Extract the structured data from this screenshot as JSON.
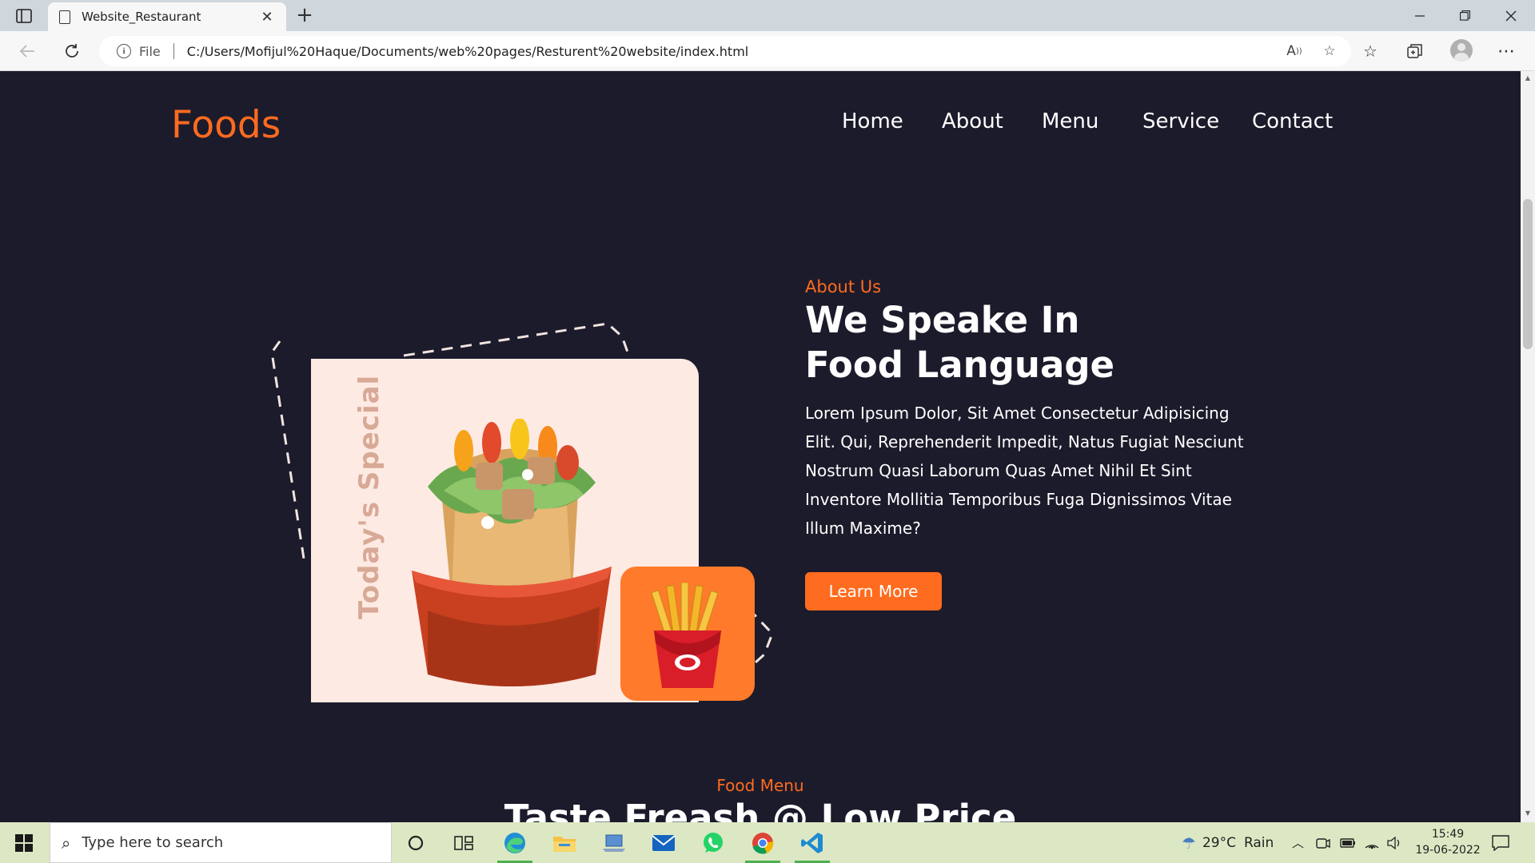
{
  "browser": {
    "tab_title": "Website_Restaurant",
    "address_prefix": "File",
    "url": "C:/Users/Mofijul%20Haque/Documents/web%20pages/Resturent%20website/index.html"
  },
  "site": {
    "logo": "Foods",
    "nav": [
      "Home",
      "About",
      "Menu",
      "Service",
      "Contact"
    ],
    "art_label": "Today's Special",
    "about": {
      "tag": "About Us",
      "title_line1": "We Speake In",
      "title_line2": "Food Language",
      "body": "Lorem Ipsum Dolor, Sit Amet Consectetur Adipisicing Elit. Qui, Reprehenderit Impedit, Natus Fugiat Nesciunt Nostrum Quasi Laborum Quas Amet Nihil Et Sint Inventore Mollitia Temporibus Fuga Dignissimos Vitae Illum Maxime?",
      "button": "Learn More"
    },
    "menu": {
      "tag": "Food Menu",
      "title": "Taste Freash @ Low Price"
    }
  },
  "taskbar": {
    "search_placeholder": "Type here to search",
    "weather_temp": "29°C",
    "weather_text": "Rain",
    "time": "15:49",
    "date": "19-06-2022"
  },
  "colors": {
    "page_bg": "#1c1b2b",
    "accent": "#ff6b1f",
    "card_bg": "#fdeae3",
    "taskbar_bg": "#dce8c3"
  }
}
